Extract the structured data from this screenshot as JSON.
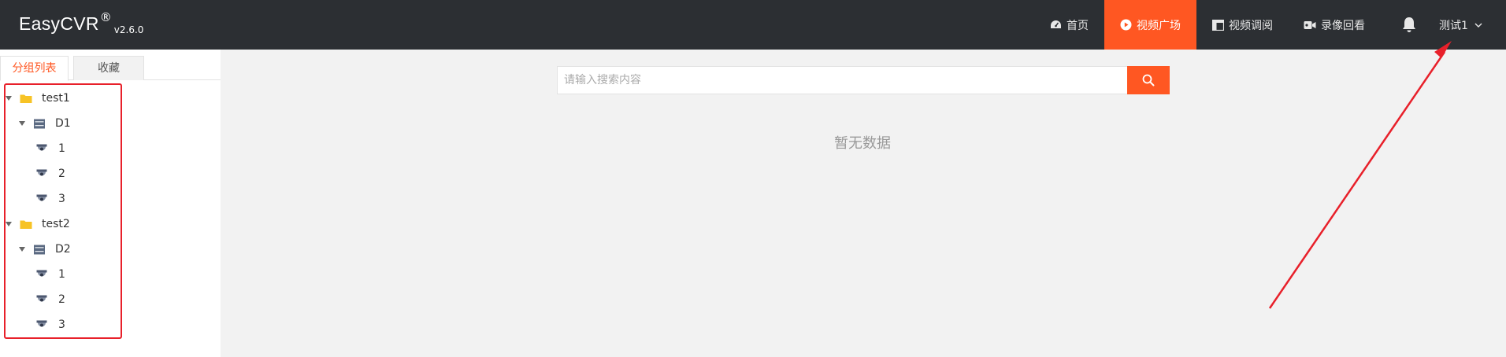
{
  "app": {
    "name": "EasyCVR",
    "reg": "®",
    "version": "v2.6.0"
  },
  "nav": {
    "home": {
      "label": "首页",
      "icon": "dashboard-icon"
    },
    "square": {
      "label": "视频广场",
      "icon": "play-circle-icon",
      "active": true
    },
    "call": {
      "label": "视频调阅",
      "icon": "layout-icon"
    },
    "playback": {
      "label": "录像回看",
      "icon": "video-camera-icon"
    }
  },
  "user": {
    "name": "测试1"
  },
  "tabs": {
    "group": "分组列表",
    "favorites": "收藏"
  },
  "tree": {
    "groups": [
      {
        "name": "test1",
        "device": "D1",
        "channels": [
          "1",
          "2",
          "3"
        ]
      },
      {
        "name": "test2",
        "device": "D2",
        "channels": [
          "1",
          "2",
          "3"
        ]
      }
    ]
  },
  "search": {
    "placeholder": "请输入搜索内容"
  },
  "empty": "暂无数据",
  "colors": {
    "accent": "#ff5722",
    "header": "#2c2f33",
    "annotation": "#e8202a"
  }
}
